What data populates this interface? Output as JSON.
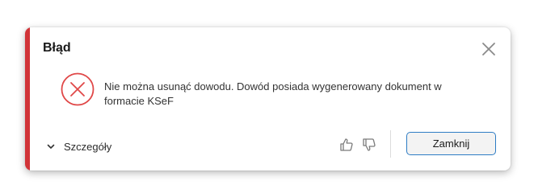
{
  "dialog": {
    "title": "Błąd",
    "message": "Nie można usunąć dowodu. Dowód posiada wygenerowany dokument w formacie KSeF",
    "details_label": "Szczegóły",
    "close_button_label": "Zamknij",
    "icons": {
      "close": "close-icon",
      "error": "error-icon",
      "chevron": "chevron-down-icon",
      "thumbs_up": "thumbs-up-icon",
      "thumbs_down": "thumbs-down-icon"
    },
    "colors": {
      "accent": "#d13438",
      "error_icon": "#e04848",
      "button_border": "#2d7cc4"
    }
  }
}
